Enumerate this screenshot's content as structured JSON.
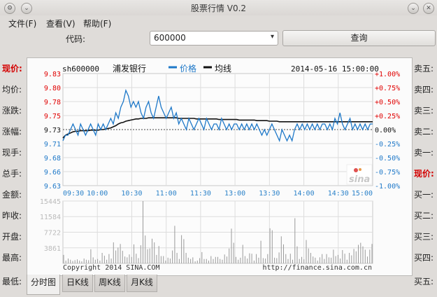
{
  "window": {
    "title": "股票行情 V0.2",
    "left_button_1": "⚙",
    "left_button_2": "⌄"
  },
  "menu": [
    {
      "label": "文件(F)"
    },
    {
      "label": "查看(V)"
    },
    {
      "label": "帮助(F)"
    }
  ],
  "toolbar": {
    "code_label": "代码:",
    "code_value": "600000",
    "combo_arrow": "▾",
    "query_label": "查询"
  },
  "left_labels": [
    "现价:",
    "均价:",
    "涨跌:",
    "涨幅:",
    "现手:",
    "总手:",
    "金额:",
    "昨收:",
    "开盘:",
    "最高:",
    "最低:"
  ],
  "right_labels": [
    "卖五:",
    "卖四:",
    "卖三:",
    "卖二:",
    "卖一:",
    "现价:",
    "买一:",
    "买二:",
    "买三:",
    "买四:",
    "买五:"
  ],
  "chart_header": {
    "code": "sh600000",
    "name": "浦发银行",
    "legend_price": "价格",
    "legend_avg": "均线",
    "datetime": "2014-05-16 15:00:00"
  },
  "sina_logo": "sina",
  "chart_data": {
    "type": "line",
    "price_axis": [
      "9.83",
      "9.80",
      "9.78",
      "9.75",
      "9.73",
      "9.71",
      "9.68",
      "9.66",
      "9.63"
    ],
    "pct_axis": [
      "+1.00%",
      "+0.75%",
      "+0.50%",
      "+0.25%",
      "0.00%",
      "-0.25%",
      "-0.50%",
      "-0.75%",
      "-1.00%"
    ],
    "time_axis": [
      "09:30",
      "10:00",
      "10:30",
      "11:00",
      "11:30",
      "13:00",
      "13:30",
      "14:00",
      "14:30",
      "15:00"
    ],
    "ylim": [
      9.63,
      9.83
    ],
    "prev_close": 9.73,
    "series": [
      {
        "name": "价格",
        "color": "#1e78c8",
        "values": [
          9.71,
          9.72,
          9.72,
          9.73,
          9.74,
          9.73,
          9.72,
          9.74,
          9.73,
          9.72,
          9.73,
          9.74,
          9.73,
          9.72,
          9.74,
          9.73,
          9.74,
          9.73,
          9.74,
          9.75,
          9.74,
          9.76,
          9.75,
          9.77,
          9.78,
          9.8,
          9.79,
          9.77,
          9.78,
          9.77,
          9.78,
          9.76,
          9.75,
          9.77,
          9.78,
          9.76,
          9.75,
          9.77,
          9.79,
          9.77,
          9.76,
          9.75,
          9.76,
          9.77,
          9.75,
          9.76,
          9.74,
          9.75,
          9.74,
          9.73,
          9.75,
          9.74,
          9.73,
          9.74,
          9.75,
          9.74,
          9.73,
          9.75,
          9.74,
          9.73,
          9.74,
          9.74,
          9.73,
          9.75,
          9.74,
          9.73,
          9.74,
          9.73,
          9.74,
          9.74,
          9.73,
          9.74,
          9.73,
          9.74,
          9.73,
          9.74,
          9.73,
          9.74,
          9.73,
          9.72,
          9.73,
          9.72,
          9.73,
          9.74,
          9.73,
          9.72,
          9.71,
          9.73,
          9.72,
          9.71,
          9.72,
          9.71,
          9.73,
          9.74,
          9.73,
          9.74,
          9.73,
          9.74,
          9.73,
          9.74,
          9.73,
          9.74,
          9.73,
          9.74,
          9.74,
          9.73,
          9.74,
          9.73,
          9.75,
          9.74,
          9.76,
          9.74,
          9.73,
          9.74,
          9.75,
          9.73,
          9.74,
          9.73,
          9.74,
          9.73,
          9.74,
          9.73,
          9.74,
          9.74
        ]
      },
      {
        "name": "均线",
        "color": "#111111",
        "values": [
          9.715,
          9.72,
          9.722,
          9.724,
          9.726,
          9.727,
          9.727,
          9.728,
          9.728,
          9.728,
          9.728,
          9.729,
          9.729,
          9.729,
          9.729,
          9.73,
          9.73,
          9.731,
          9.732,
          9.733,
          9.735,
          9.737,
          9.74,
          9.742,
          9.743,
          9.745,
          9.746,
          9.747,
          9.748,
          9.749,
          9.749,
          9.75,
          9.75,
          9.75,
          9.751,
          9.751,
          9.751,
          9.751,
          9.751,
          9.751,
          9.751,
          9.751,
          9.751,
          9.751,
          9.751,
          9.751,
          9.75,
          9.75,
          9.75,
          9.75,
          9.75,
          9.75,
          9.75,
          9.749,
          9.749,
          9.749,
          9.749,
          9.749,
          9.749,
          9.749,
          9.749,
          9.749,
          9.748,
          9.748,
          9.748,
          9.748,
          9.748,
          9.748,
          9.748,
          9.748,
          9.747,
          9.747,
          9.747,
          9.747,
          9.747,
          9.747,
          9.747,
          9.746,
          9.746,
          9.746,
          9.746,
          9.746,
          9.745,
          9.745,
          9.745,
          9.745,
          9.744,
          9.744,
          9.744,
          9.744,
          9.744,
          9.744,
          9.744,
          9.744,
          9.744,
          9.744,
          9.744,
          9.744,
          9.744,
          9.744,
          9.744,
          9.744,
          9.744,
          9.744,
          9.744,
          9.744,
          9.744,
          9.744,
          9.744,
          9.744,
          9.744,
          9.744,
          9.744,
          9.744,
          9.744,
          9.744,
          9.744,
          9.744,
          9.744,
          9.744,
          9.744,
          9.744,
          9.744,
          9.744
        ]
      }
    ],
    "volume_axis": [
      "15445",
      "11584",
      "7722",
      "3861"
    ],
    "volume_max": 15445,
    "volume": [
      2100,
      700,
      1200,
      900,
      600,
      800,
      1000,
      700,
      500,
      1200,
      900,
      800,
      3500,
      1500,
      900,
      1100,
      700,
      2600,
      1900,
      900,
      2300,
      1200,
      5200,
      3200,
      3900,
      4800,
      3100,
      1700,
      1500,
      2200,
      1600,
      4700,
      2400,
      1300,
      4500,
      15445,
      6900,
      3500,
      3700,
      6100,
      5200,
      2100,
      4300,
      1800,
      1800,
      700,
      1400,
      1200,
      3200,
      9300,
      2600,
      1100,
      7000,
      6000,
      2600,
      1400,
      1100,
      1500,
      500,
      700,
      1300,
      2800,
      1100,
      1100,
      700,
      1800,
      1100,
      1600,
      1600,
      1100,
      900,
      2200,
      1700,
      3700,
      8600,
      5100,
      1600,
      900,
      1400,
      4600,
      1800,
      1200,
      2500,
      2400,
      700,
      2300,
      1400,
      5600,
      1300,
      1200,
      2300,
      8700,
      8200,
      1400,
      1300,
      2700,
      6700,
      4700,
      2300,
      1100,
      2400,
      900,
      11200,
      4200,
      1100,
      1600,
      1000,
      5800,
      3700,
      2600,
      1700,
      1400,
      700,
      1500,
      2300,
      1100,
      2300,
      1500,
      1400,
      3400,
      1800,
      2100,
      1200,
      3300,
      2400,
      900,
      2600,
      2000,
      3600,
      3000,
      4600,
      5100,
      4200,
      3400,
      1700,
      3400,
      4800
    ],
    "copyright": "Copyright 2014 SINA.COM",
    "source_url": "http://finance.sina.com.cn"
  },
  "tabs": [
    {
      "label": "分时图",
      "active": true
    },
    {
      "label": "日K线",
      "active": false
    },
    {
      "label": "周K线",
      "active": false
    },
    {
      "label": "月K线",
      "active": false
    }
  ],
  "colors": {
    "price_line": "#1e78c8",
    "avg_line": "#111111",
    "up_red": "#e00000",
    "axis_blue": "#2b82c9"
  }
}
